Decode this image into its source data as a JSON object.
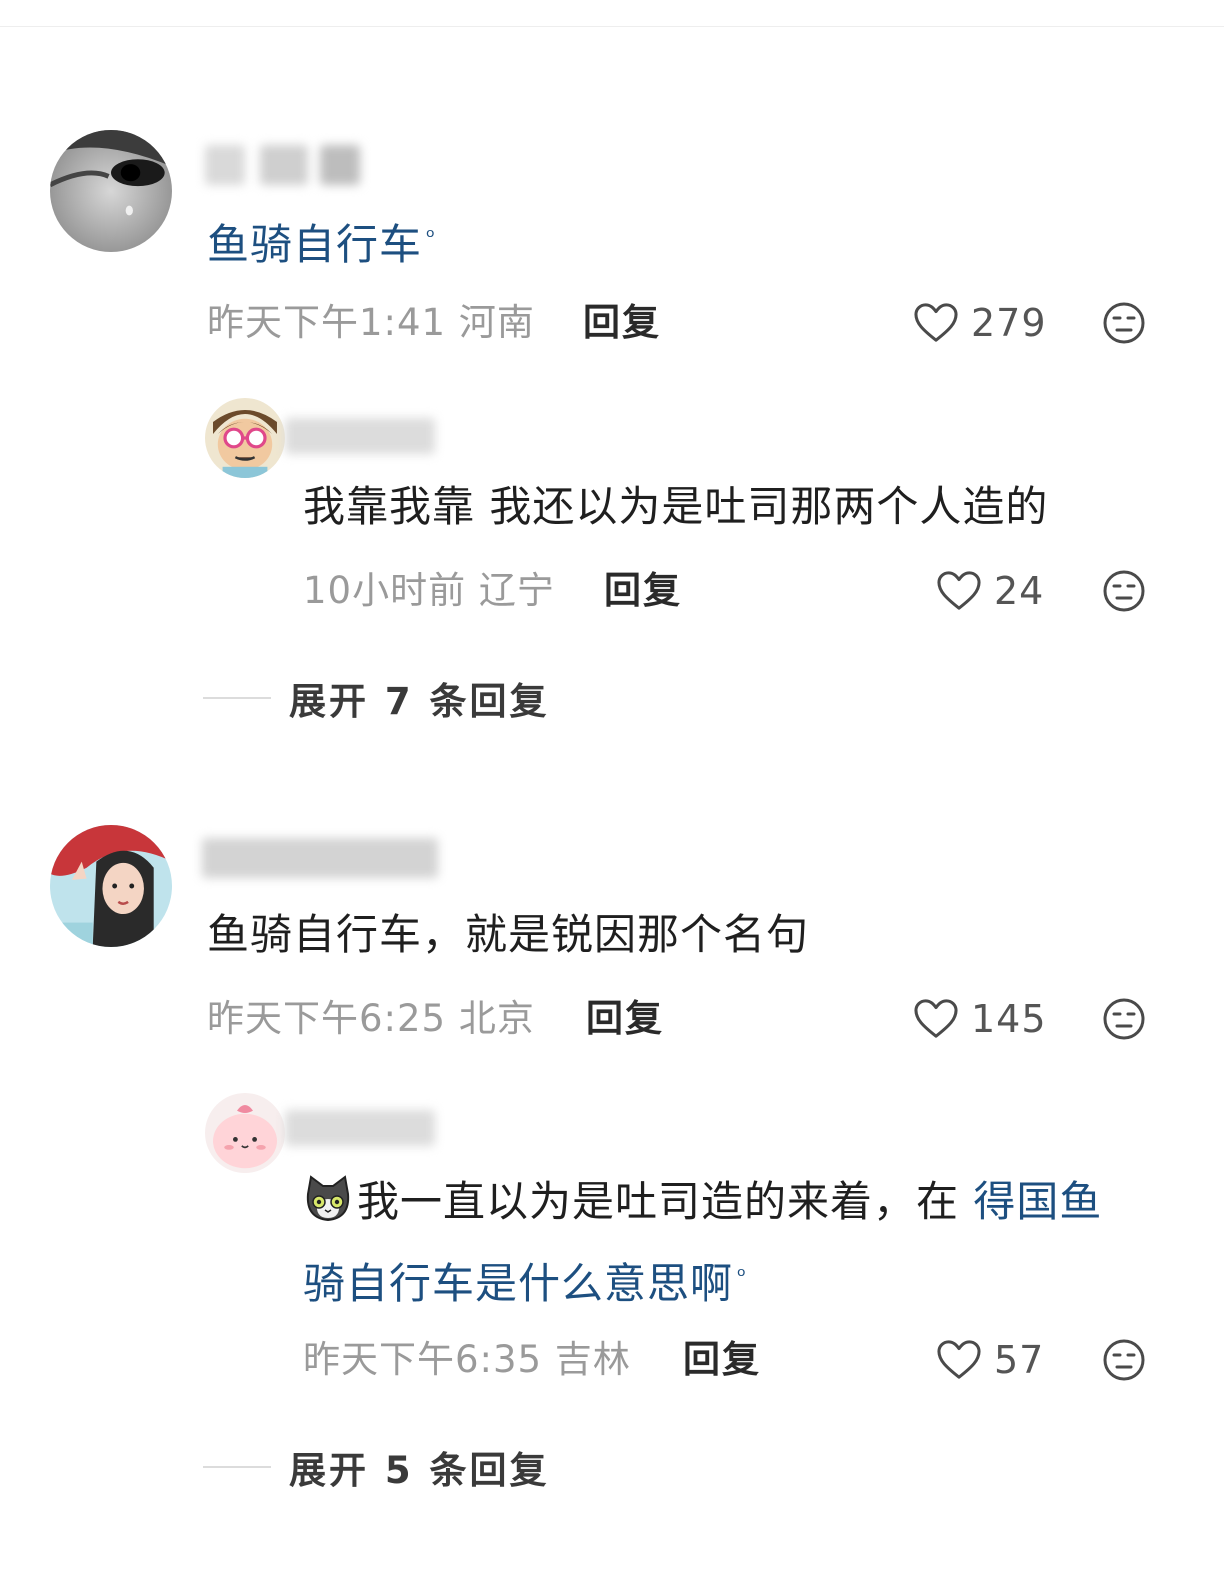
{
  "comments": [
    {
      "text_link": "鱼骑自行车",
      "time": "昨天下午1:41",
      "location": "河南",
      "reply_label": "回复",
      "likes": "279",
      "reply": {
        "text": "我靠我靠 我还以为是吐司那两个人造的",
        "time": "10小时前",
        "location": "辽宁",
        "reply_label": "回复",
        "likes": "24"
      },
      "expand_label": "展开 7 条回复"
    },
    {
      "text": "鱼骑自行车，就是锐因那个名句",
      "time": "昨天下午6:25",
      "location": "北京",
      "reply_label": "回复",
      "likes": "145",
      "reply": {
        "text": "我一直以为是吐司造的来着，在 ",
        "text_link_part1": "得国鱼",
        "text_link_part2": "骑自行车是什么意思啊",
        "time": "昨天下午6:35",
        "location": "吉林",
        "reply_label": "回复",
        "likes": "57"
      },
      "expand_label": "展开 5 条回复"
    }
  ],
  "icons": {
    "like": "heart-outline-icon",
    "dislike": "neutral-face-icon",
    "search_hint": "search-icon",
    "emoji": "cat-emoji-icon"
  },
  "colors": {
    "link": "#1d4f80",
    "meta": "#9a9a9a",
    "background": "#ffffff"
  }
}
